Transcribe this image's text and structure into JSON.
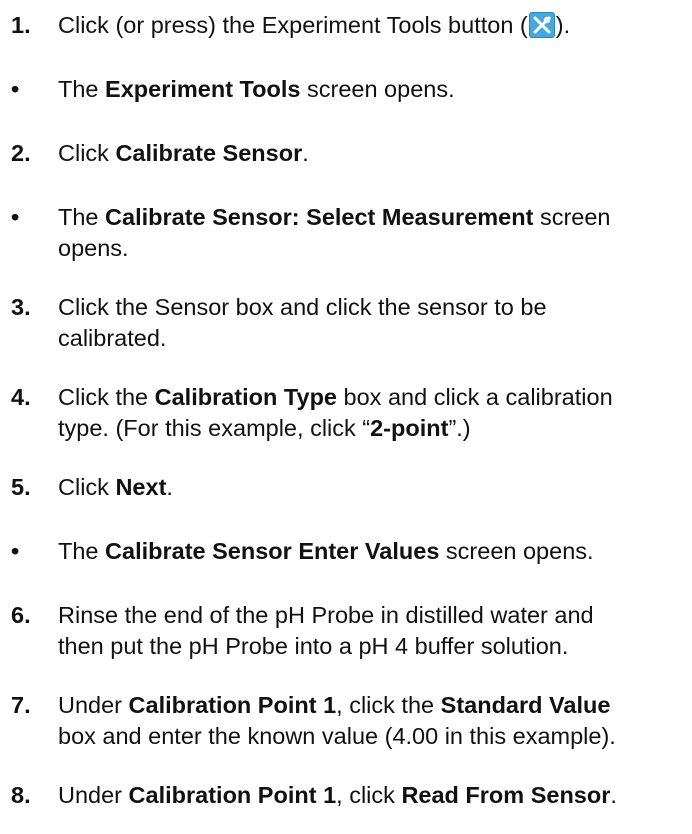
{
  "steps": [
    {
      "marker": "1.",
      "parts": [
        "Click (or press) the Experiment Tools button (",
        ")."
      ]
    },
    {
      "marker": "•",
      "parts": [
        "The ",
        "Experiment Tools",
        " screen opens."
      ]
    },
    {
      "marker": "2.",
      "parts": [
        "Click ",
        "Calibrate Sensor",
        "."
      ]
    },
    {
      "marker": "•",
      "parts": [
        "The ",
        "Calibrate Sensor: Select Measurement",
        " screen",
        "opens."
      ]
    },
    {
      "marker": "3.",
      "parts": [
        "Click the Sensor box and click the sensor to be",
        "calibrated."
      ]
    },
    {
      "marker": "4.",
      "parts": [
        "Click the ",
        "Calibration Type",
        " box and click a calibration",
        "type. (For this example, click “",
        "2-point",
        "”.)"
      ]
    },
    {
      "marker": "5.",
      "parts": [
        "Click ",
        "Next",
        "."
      ]
    },
    {
      "marker": "•",
      "parts": [
        "The ",
        "Calibrate Sensor Enter Values",
        " screen opens."
      ]
    },
    {
      "marker": "6.",
      "parts": [
        "Rinse the end of the pH Probe in distilled water and",
        "then put the pH Probe into a pH 4 buffer solution."
      ]
    },
    {
      "marker": "7.",
      "parts": [
        "Under ",
        "Calibration Point 1",
        ", click the ",
        "Standard Value",
        "box and enter the known value (4.00 in this example)."
      ]
    },
    {
      "marker": "8.",
      "parts": [
        "Under ",
        "Calibration Point 1",
        ", click ",
        "Read From Sensor",
        "."
      ]
    }
  ],
  "icons": {
    "experiment_tools": "experiment-tools-icon",
    "icon_color": "#46a8dc"
  }
}
